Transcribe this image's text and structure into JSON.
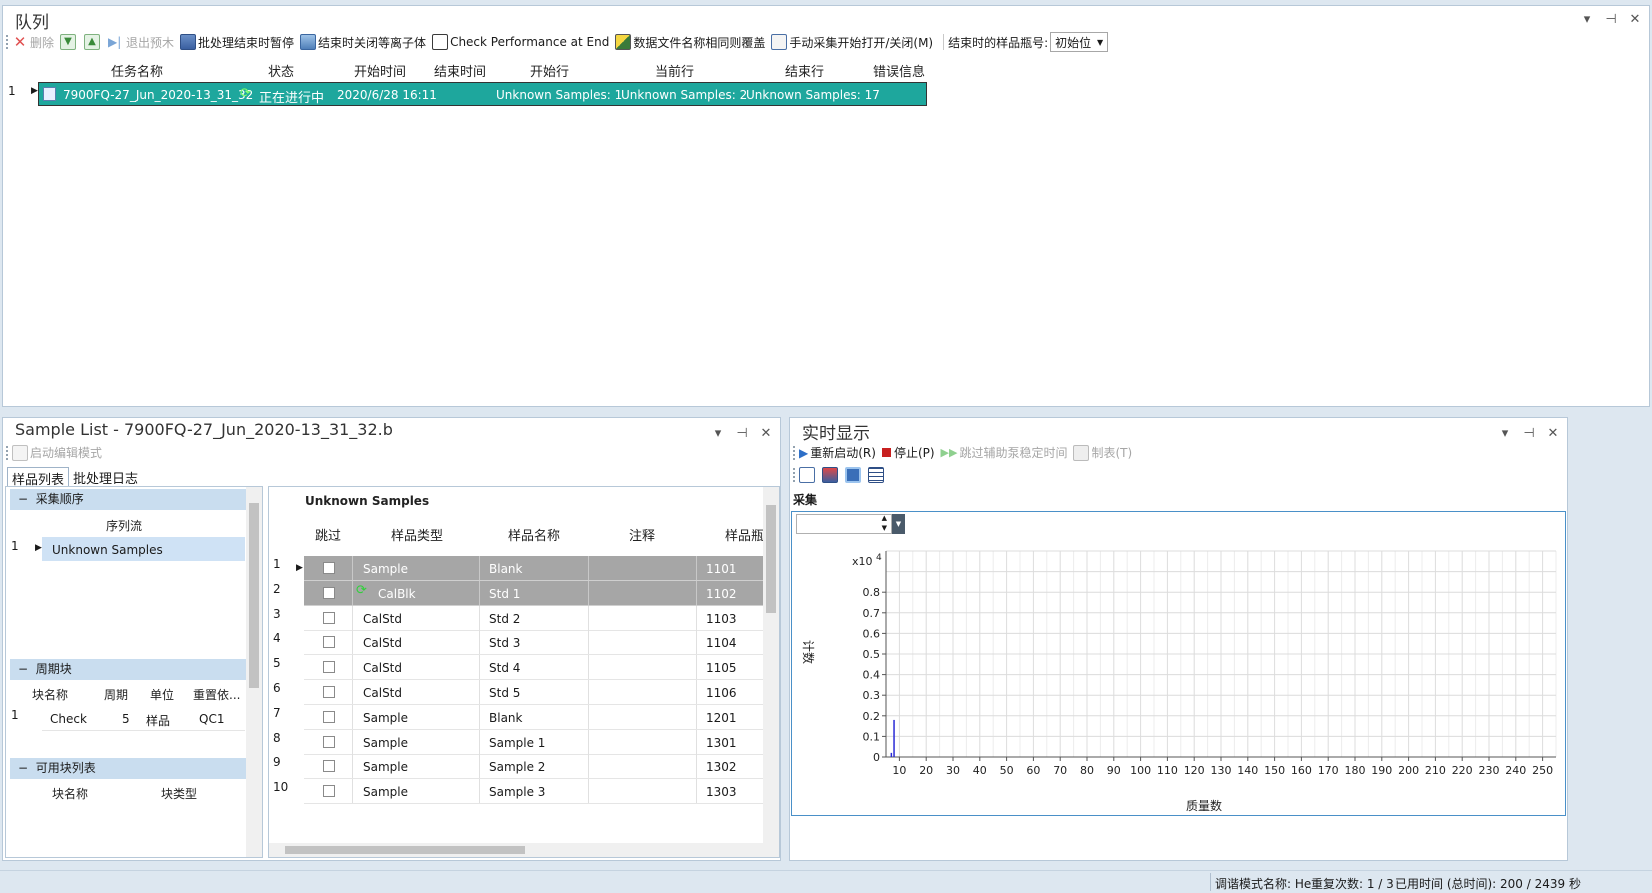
{
  "queue": {
    "title": "队列",
    "toolbar": {
      "delete": "删除",
      "exit_preview": "退出预木",
      "pause_batch": "批处理结束时暂停",
      "close_plasma": "结束时关闭等离子体",
      "check_perf": "Check Performance at End",
      "overwrite": "数据文件名称相同则覆盖",
      "manual_toggle": "手动采集开始打开/关闭(M)",
      "end_vial_label": "结束时的样品瓶号:",
      "end_vial_value": "初始位"
    },
    "columns": [
      "任务名称",
      "状态",
      "开始时间",
      "结束时间",
      "开始行",
      "当前行",
      "结束行",
      "错误信息"
    ],
    "rows": [
      {
        "num": "1",
        "name": "7900FQ-27_Jun_2020-13_31_32",
        "status": "正在进行中",
        "start_time": "2020/6/28 16:11",
        "end_time": "",
        "start_row": "Unknown Samples: 1",
        "current_row": "Unknown Samples: 2",
        "end_row": "Unknown Samples: 17",
        "error": ""
      }
    ]
  },
  "sample_list": {
    "title": "Sample List - 7900FQ-27_Jun_2020-13_31_32.b",
    "toolbar_edit": "启动编辑模式",
    "tabs": [
      "样品列表",
      "批处理日志"
    ],
    "sequence": {
      "header": "采集顺序",
      "col": "序列流",
      "rows": [
        {
          "num": "1",
          "name": "Unknown Samples"
        }
      ]
    },
    "periodic": {
      "header": "周期块",
      "cols": [
        "块名称",
        "周期",
        "单位",
        "重置依..."
      ],
      "rows": [
        {
          "num": "1",
          "name": "Check",
          "period": "5",
          "unit": "样品",
          "reset": "QC1"
        }
      ]
    },
    "available": {
      "header": "可用块列表",
      "cols": [
        "块名称",
        "块类型"
      ]
    },
    "grid": {
      "group": "Unknown Samples",
      "cols": [
        "跳过",
        "样品类型",
        "样品名称",
        "注释",
        "样品瓶"
      ],
      "rows": [
        {
          "num": "1",
          "type": "Sample",
          "name": "Blank",
          "note": "",
          "vial": "1101"
        },
        {
          "num": "2",
          "type": "CalBlk",
          "name": "Std 1",
          "note": "",
          "vial": "1102"
        },
        {
          "num": "3",
          "type": "CalStd",
          "name": "Std 2",
          "note": "",
          "vial": "1103"
        },
        {
          "num": "4",
          "type": "CalStd",
          "name": "Std 3",
          "note": "",
          "vial": "1104"
        },
        {
          "num": "5",
          "type": "CalStd",
          "name": "Std 4",
          "note": "",
          "vial": "1105"
        },
        {
          "num": "6",
          "type": "CalStd",
          "name": "Std 5",
          "note": "",
          "vial": "1106"
        },
        {
          "num": "7",
          "type": "Sample",
          "name": "Blank",
          "note": "",
          "vial": "1201"
        },
        {
          "num": "8",
          "type": "Sample",
          "name": "Sample 1",
          "note": "",
          "vial": "1301"
        },
        {
          "num": "9",
          "type": "Sample",
          "name": "Sample 2",
          "note": "",
          "vial": "1302"
        },
        {
          "num": "10",
          "type": "Sample",
          "name": "Sample 3",
          "note": "",
          "vial": "1303"
        }
      ]
    }
  },
  "realtime": {
    "title": "实时显示",
    "toolbar": {
      "restart": "重新启动(R)",
      "stop": "停止(P)",
      "skip": "跳过辅助泵稳定时间",
      "print": "制表(T)"
    },
    "section": "采集"
  },
  "chart_data": {
    "type": "bar",
    "ylabel": "计数",
    "xlabel": "质量数",
    "y_multiplier": "x10",
    "y_exponent": "4",
    "ylim": [
      0,
      1
    ],
    "yticks": [
      "0",
      "0.1",
      "0.2",
      "0.3",
      "0.4",
      "0.5",
      "0.6",
      "0.7",
      "0.8"
    ],
    "xlim": [
      5,
      255
    ],
    "xticks": [
      "10",
      "20",
      "30",
      "40",
      "50",
      "60",
      "70",
      "80",
      "90",
      "100",
      "110",
      "120",
      "130",
      "140",
      "150",
      "160",
      "170",
      "180",
      "190",
      "200",
      "210",
      "220",
      "230",
      "240",
      "250"
    ],
    "x": [
      7,
      8
    ],
    "values": [
      0.02,
      0.18
    ],
    "grid": true
  },
  "status_bar": {
    "tune_mode": "调谐模式名称: He",
    "repeat": "重复次数: 1 / 3",
    "elapsed": "已用时间 (总时间): 200 / 2439 秒"
  }
}
